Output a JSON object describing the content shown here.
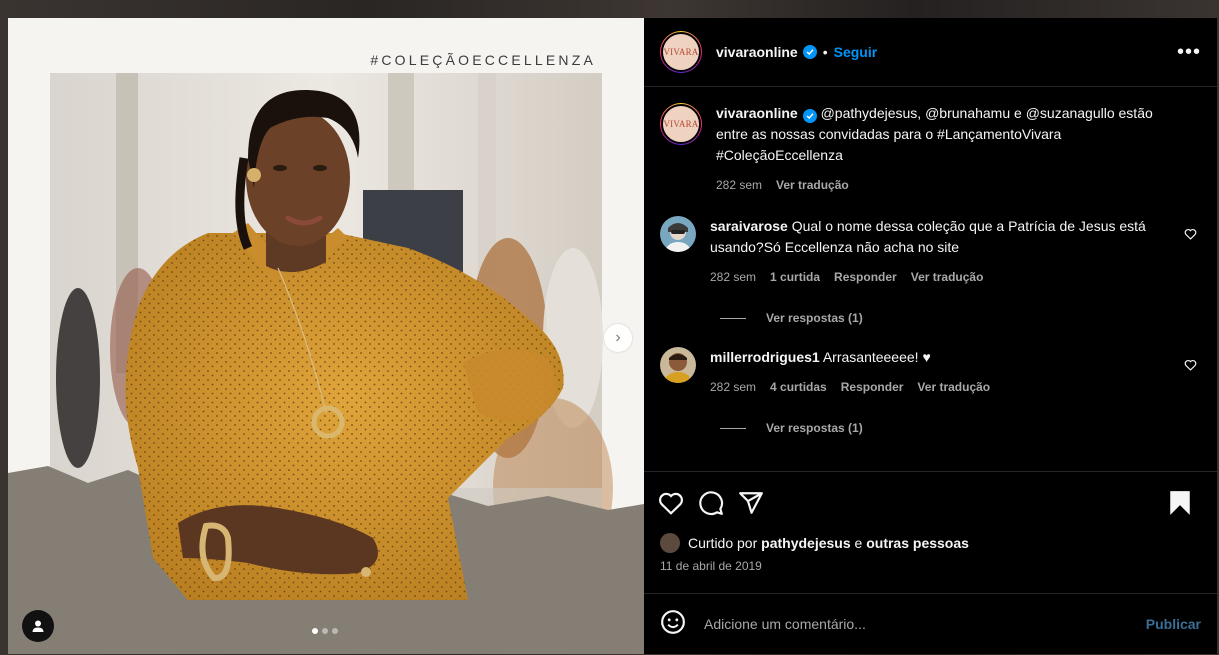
{
  "media": {
    "hashtag_overlay": "#COLEÇÃOECCELLENZA",
    "carousel_total": 3,
    "carousel_active": 1
  },
  "header": {
    "avatar_text": "VIVARA",
    "username": "vivaraonline",
    "separator": "•",
    "follow_label": "Seguir",
    "more_label": "•••"
  },
  "caption": {
    "username": "vivaraonline",
    "text": "@pathydejesus, @brunahamu e @suzanagullo estão entre as nossas convidadas para o #LançamentoVivara #ColeçãoEccellenza",
    "time": "282 sem",
    "translate": "Ver tradução"
  },
  "comments": [
    {
      "username": "saraivarose",
      "text": "Qual o nome dessa coleção que a Patrícia de Jesus está usando?Só Eccellenza não acha no site",
      "time": "282 sem",
      "likes": "1 curtida",
      "reply": "Responder",
      "translate": "Ver tradução",
      "view_replies": "Ver respostas (1)"
    },
    {
      "username": "millerrodrigues1",
      "text": "Arrasanteeeee! ♥",
      "time": "282 sem",
      "likes": "4 curtidas",
      "reply": "Responder",
      "translate": "Ver tradução",
      "view_replies": "Ver respostas (1)"
    }
  ],
  "likes": {
    "prefix": "Curtido por",
    "user": "pathydejesus",
    "connector": "e",
    "others": "outras pessoas",
    "date": "11 de abril de 2019"
  },
  "composer": {
    "placeholder": "Adicione um comentário...",
    "publish_label": "Publicar"
  },
  "colors": {
    "accent": "#0095f6",
    "background": "#000000",
    "muted_text": "#a8a8a8"
  }
}
